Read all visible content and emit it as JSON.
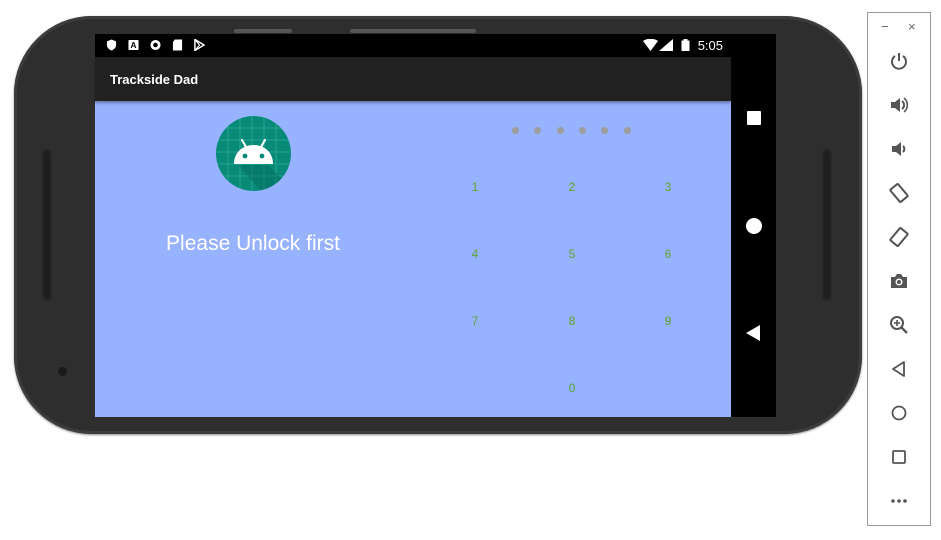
{
  "status_bar": {
    "time": "5:05",
    "left_icons": [
      "shield-icon",
      "a-box-icon",
      "circle-icon",
      "sd-card-icon",
      "play-store-icon"
    ],
    "right_icons": [
      "wifi-icon",
      "signal-icon",
      "battery-icon"
    ]
  },
  "app_bar": {
    "title": "Trackside Dad"
  },
  "lock_screen": {
    "message": "Please Unlock first",
    "pin_dots": 6,
    "keys": [
      "1",
      "2",
      "3",
      "4",
      "5",
      "6",
      "7",
      "8",
      "9",
      "0"
    ]
  },
  "colors": {
    "content_background": "#97b2ff",
    "key_text": "#5da33a",
    "logo_background": "#078a78",
    "pin_dot": "#9e9e9e"
  },
  "nav_bar": {
    "icons": [
      "recents-icon",
      "home-icon",
      "back-icon"
    ]
  },
  "emulator_panel": {
    "window_controls": {
      "minimize": "−",
      "close": "×"
    },
    "tools": [
      "power-icon",
      "volume-up-icon",
      "volume-down-icon",
      "rotate-left-icon",
      "rotate-right-icon",
      "camera-icon",
      "zoom-icon",
      "back-icon",
      "home-icon",
      "overview-icon",
      "more-icon"
    ]
  }
}
